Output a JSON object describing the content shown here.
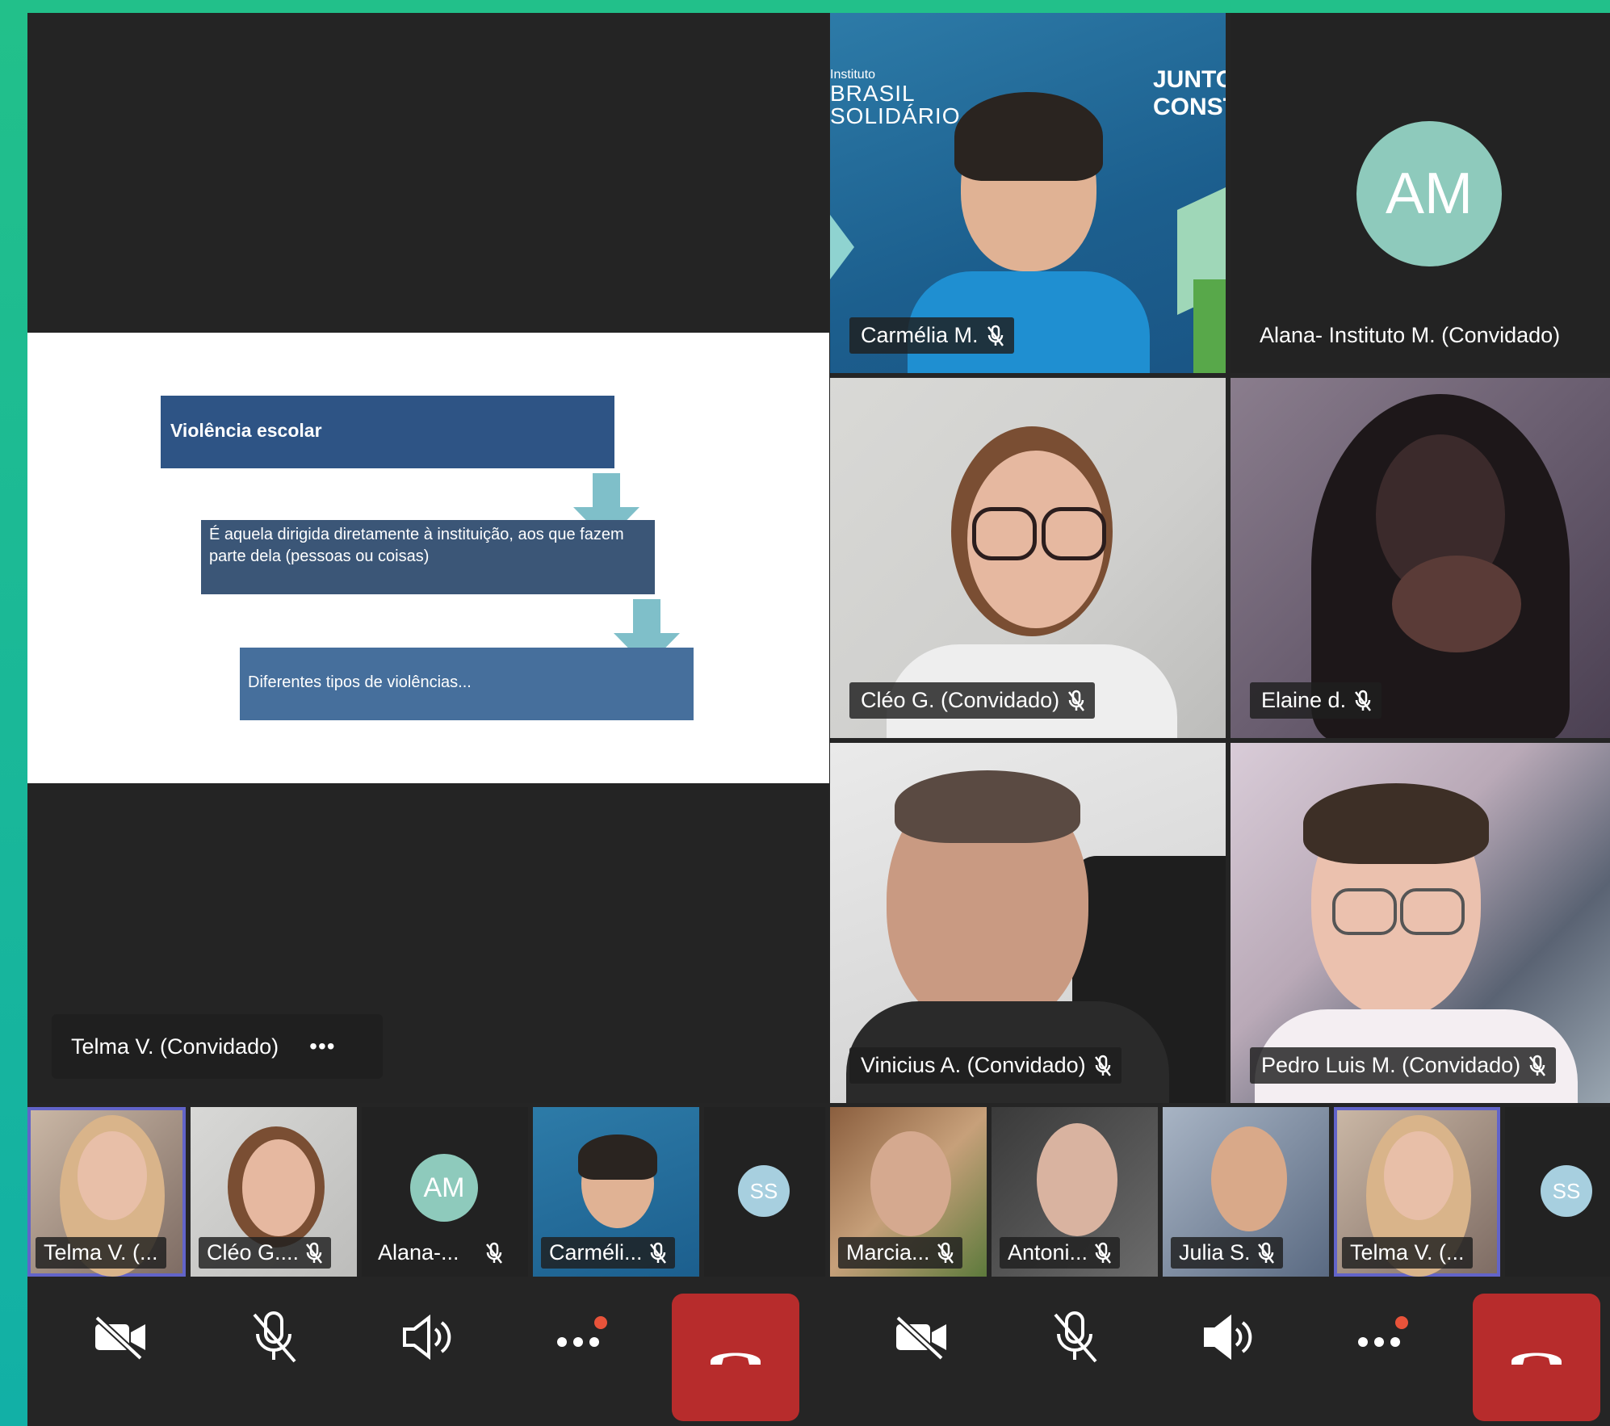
{
  "slide": {
    "title": "Violência escolar",
    "definition": "É aquela dirigida diretamente à instituição, aos que fazem parte dela (pessoas ou coisas)",
    "types": "Diferentes tipos de violências..."
  },
  "speaker": {
    "name": "Telma V. (Convidado)",
    "more": "•••"
  },
  "grid": [
    {
      "name": "Carmélia M.",
      "muted": true,
      "bg_lines": [
        "Instituto",
        "BRASIL",
        "SOLIDÁRIO"
      ],
      "bg_right": [
        "JUNTOS",
        "CONSTR"
      ]
    },
    {
      "name": "Alana- Instituto M. (Convidado)",
      "muted": true,
      "initials": "AM"
    },
    {
      "name": "Cléo G. (Convidado)",
      "muted": true
    },
    {
      "name": "Elaine d.",
      "muted": true
    },
    {
      "name": "Vinicius A. (Convidado)",
      "muted": true
    },
    {
      "name": "Pedro Luis M. (Convidado)",
      "muted": true
    }
  ],
  "filmstrip": [
    {
      "name": "Telma V. (...",
      "muted": false,
      "active": true
    },
    {
      "name": "Cléo G....",
      "muted": true
    },
    {
      "name": "Alana-...",
      "muted": true,
      "initials": "AM"
    },
    {
      "name": "Carméli...",
      "muted": true
    },
    {
      "initials": "SS"
    },
    {
      "name": "Marcia...",
      "muted": true
    },
    {
      "name": "Antoni...",
      "muted": true
    },
    {
      "name": "Julia S.",
      "muted": true
    },
    {
      "name": "Telma V. (...",
      "muted": false,
      "active": true
    },
    {
      "initials": "SS"
    }
  ],
  "colors": {
    "hangup": "#b72c2c",
    "active_border": "#6264c9",
    "avatar": "#8ecabc",
    "notification_dot": "#e8533a"
  },
  "controls": [
    {
      "icon": "camera-off-icon"
    },
    {
      "icon": "mic-off-icon"
    },
    {
      "icon": "speaker-icon"
    },
    {
      "icon": "more-icon"
    },
    {
      "icon": "hangup-icon"
    }
  ]
}
